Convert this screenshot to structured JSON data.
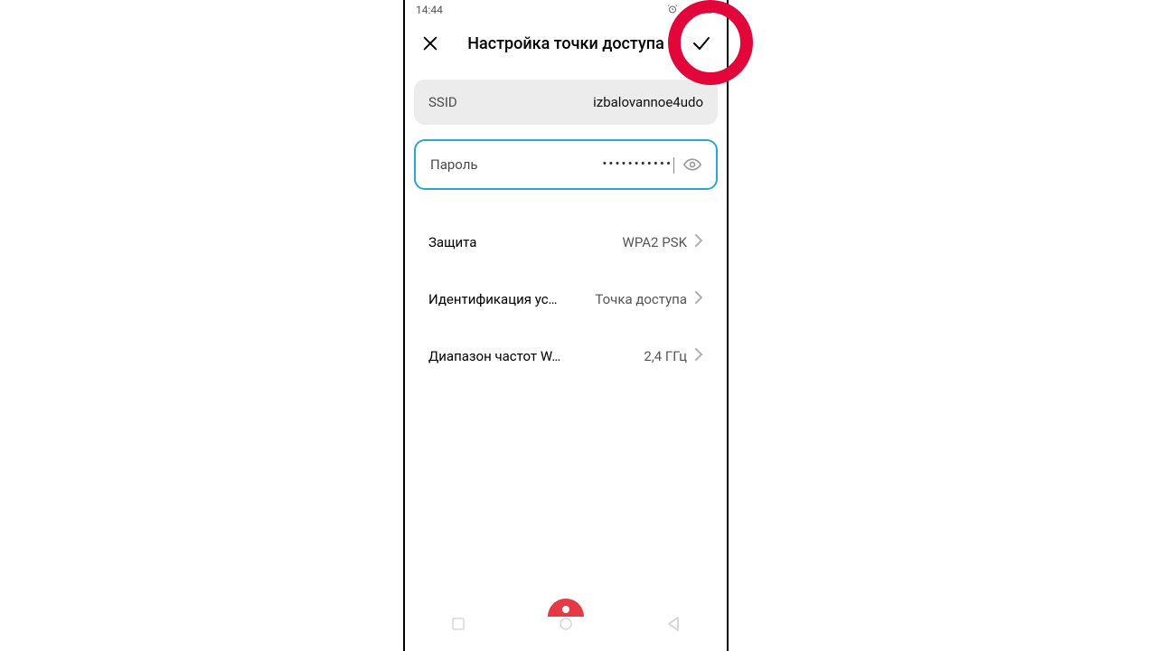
{
  "statusbar": {
    "time": "14:44"
  },
  "header": {
    "title": "Настройка точки доступа"
  },
  "fields": {
    "ssid_label": "SSID",
    "ssid_value": "izbalovannoe4udo",
    "password_label": "Пароль",
    "password_mask": "•••••••••••"
  },
  "rows": {
    "security_label": "Защита",
    "security_value": "WPA2 PSK",
    "device_id_label": "Идентификация ус…",
    "device_id_value": "Точка доступа",
    "band_label": "Диапазон частот W…",
    "band_value": "2,4 ГГц"
  }
}
